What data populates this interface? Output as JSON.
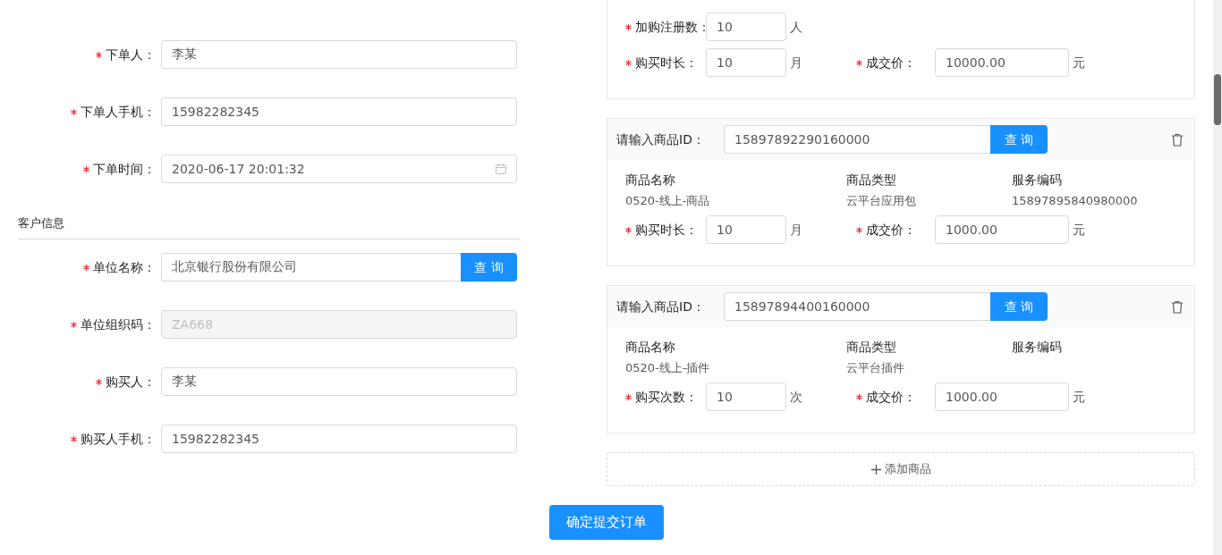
{
  "order_fields": [
    {
      "label": "下单人：",
      "required": true,
      "kind": "text",
      "value": "李某"
    },
    {
      "label": "下单人手机：",
      "required": true,
      "kind": "text",
      "value": "15982282345"
    },
    {
      "label": "下单时间：",
      "required": true,
      "kind": "date",
      "value": "2020-06-17 20:01:32"
    }
  ],
  "customer_section": {
    "title": "客户信息"
  },
  "customer_fields": [
    {
      "label": "单位名称：",
      "required": true,
      "kind": "search",
      "value": "北京银行股份有限公司",
      "button": "查 询"
    },
    {
      "label": "单位组织码：",
      "required": true,
      "kind": "disabled",
      "value": "ZA668"
    },
    {
      "label": "购买人：",
      "required": true,
      "kind": "text",
      "value": "李某"
    },
    {
      "label": "购买人手机：",
      "required": true,
      "kind": "text",
      "value": "15982282345"
    }
  ],
  "products": [
    {
      "partial": true,
      "rows": [
        [
          {
            "label": "加购注册数：",
            "required": true,
            "value": "10",
            "unit": "人"
          }
        ],
        [
          {
            "label": "购买时长：",
            "required": true,
            "value": "10",
            "unit": "月"
          },
          {
            "label": "成交价：",
            "required": true,
            "value": "10000.00",
            "unit": "元"
          }
        ]
      ]
    },
    {
      "partial": false,
      "id_label": "请输入商品ID：",
      "id_value": "15897892290160000",
      "button": "查 询",
      "info": [
        {
          "label": "商品名称",
          "value": "0520-线上-商品"
        },
        {
          "label": "商品类型",
          "value": "云平台应用包"
        },
        {
          "label": "服务编码",
          "value": "15897895840980000"
        }
      ],
      "rows": [
        [
          {
            "label": "购买时长：",
            "required": true,
            "value": "10",
            "unit": "月"
          },
          {
            "label": "成交价：",
            "required": true,
            "value": "1000.00",
            "unit": "元"
          }
        ]
      ]
    },
    {
      "partial": false,
      "id_label": "请输入商品ID：",
      "id_value": "15897894400160000",
      "button": "查 询",
      "info": [
        {
          "label": "商品名称",
          "value": "0520-线上-插件"
        },
        {
          "label": "商品类型",
          "value": "云平台插件"
        },
        {
          "label": "服务编码"
        }
      ],
      "rows": [
        [
          {
            "label": "购买次数：",
            "required": true,
            "value": "10",
            "unit": "次"
          },
          {
            "label": "成交价：",
            "required": true,
            "value": "1000.00",
            "unit": "元"
          }
        ]
      ]
    }
  ],
  "add_product": {
    "label": "添加商品"
  },
  "submit": {
    "label": "确定提交订单"
  }
}
